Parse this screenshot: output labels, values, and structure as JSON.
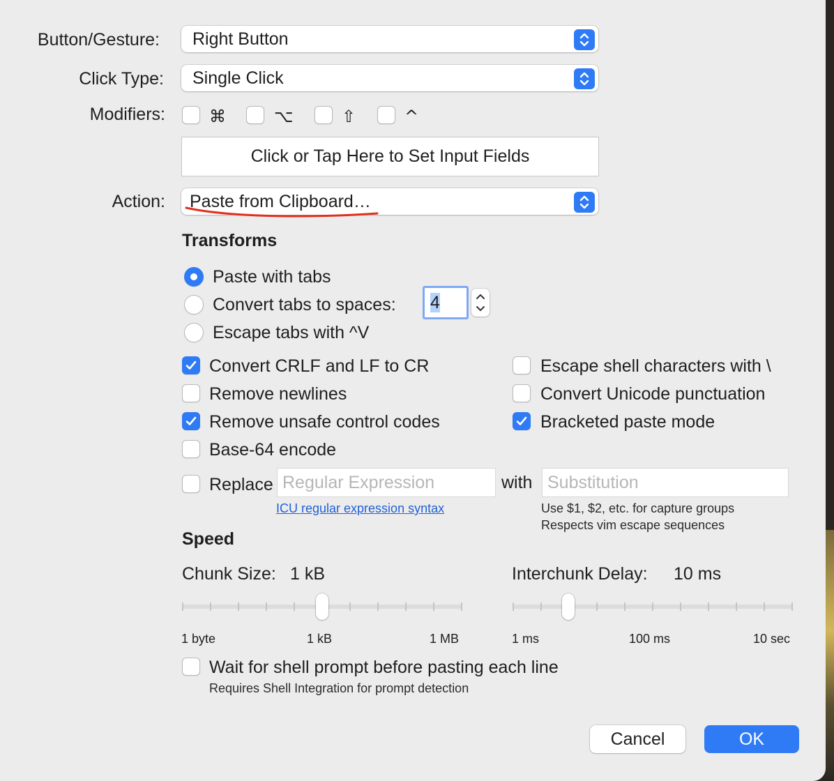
{
  "form": {
    "button_gesture_label": "Button/Gesture:",
    "button_gesture_value": "Right Button",
    "click_type_label": "Click Type:",
    "click_type_value": "Single Click",
    "modifiers_label": "Modifiers:",
    "modifiers": [
      {
        "glyph": "⌘",
        "checked": false
      },
      {
        "glyph": "⌥",
        "checked": false
      },
      {
        "glyph": "⇧",
        "checked": false
      },
      {
        "glyph": "^",
        "checked": false
      }
    ],
    "set_input_fields": "Click or Tap Here to Set Input Fields",
    "action_label": "Action:",
    "action_value": "Paste from Clipboard…"
  },
  "transforms": {
    "heading": "Transforms",
    "paste_with_tabs": "Paste with tabs",
    "convert_tabs": "Convert tabs to spaces:",
    "tab_spaces_value": "4",
    "escape_tabs": "Escape tabs with ^V",
    "selected_radio": "Paste with tabs",
    "options": {
      "convert_crlf": {
        "label": "Convert CRLF and LF to CR",
        "checked": true
      },
      "remove_newlines": {
        "label": "Remove newlines",
        "checked": false
      },
      "remove_unsafe": {
        "label": "Remove unsafe control codes",
        "checked": true
      },
      "base64": {
        "label": "Base-64 encode",
        "checked": false
      },
      "escape_shell": {
        "label": "Escape shell characters with \\",
        "checked": false
      },
      "convert_unicode": {
        "label": "Convert Unicode punctuation",
        "checked": false
      },
      "bracketed": {
        "label": "Bracketed paste mode",
        "checked": true
      }
    },
    "replace": {
      "label": "Replace",
      "checked": false,
      "regex_placeholder": "Regular Expression",
      "with_label": "with",
      "substitution_placeholder": "Substitution",
      "icu_link": "ICU regular expression syntax",
      "hint1": "Use $1, $2, etc. for capture groups",
      "hint2": "Respects vim escape sequences"
    }
  },
  "speed": {
    "heading": "Speed",
    "chunk_label": "Chunk Size:",
    "chunk_value": "1 kB",
    "chunk_ticks": [
      "1 byte",
      "1 kB",
      "1 MB"
    ],
    "chunk_position": 0.5,
    "delay_label": "Interchunk Delay:",
    "delay_value": "10 ms",
    "delay_ticks": [
      "1 ms",
      "100 ms",
      "10 sec"
    ],
    "delay_position": 0.2,
    "wait_prompt": {
      "label": "Wait for shell prompt before pasting each line",
      "checked": false
    },
    "wait_hint": "Requires Shell Integration for prompt detection"
  },
  "buttons": {
    "cancel": "Cancel",
    "ok": "OK"
  },
  "colors": {
    "accent": "#2f7bf5",
    "annotation_red": "#e0301e",
    "link": "#2060d8"
  }
}
